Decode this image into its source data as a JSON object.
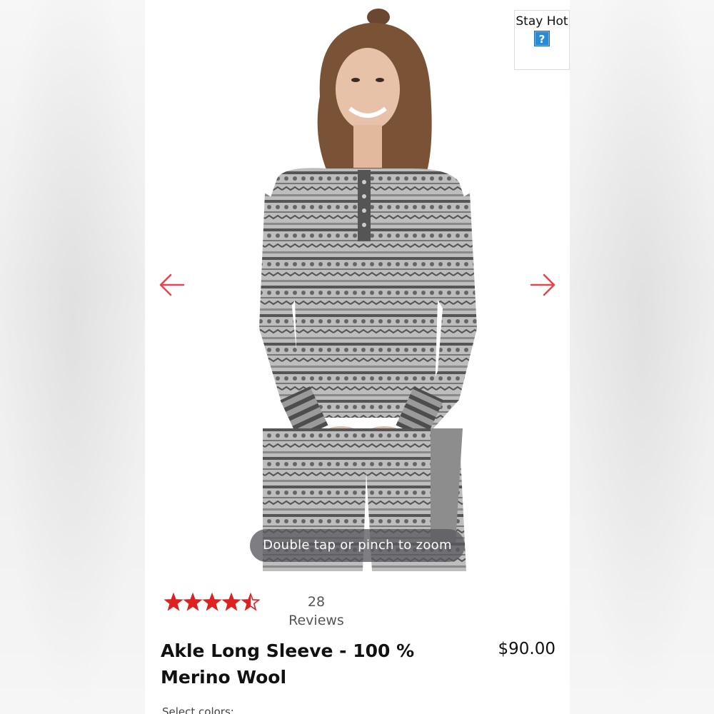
{
  "product": {
    "title": "Akle Long Sleeve - 100 % Merino Wool",
    "price": "$90.00",
    "rating": 4.5,
    "rating_max": 5,
    "review_count": "28",
    "review_label": "Reviews",
    "select_colors_label": "Select colors:"
  },
  "gallery": {
    "zoom_hint": "Double tap or pinch to zoom"
  },
  "widget": {
    "label": "Stay Hot",
    "help_icon": "?"
  },
  "colors": {
    "accent": "#e8434f",
    "star": "#e02020",
    "help_blue": "#2a8ad4"
  },
  "icons": {
    "prev": "arrow-left-icon",
    "next": "arrow-right-icon",
    "help": "question-mark-icon",
    "star": "star-icon"
  }
}
